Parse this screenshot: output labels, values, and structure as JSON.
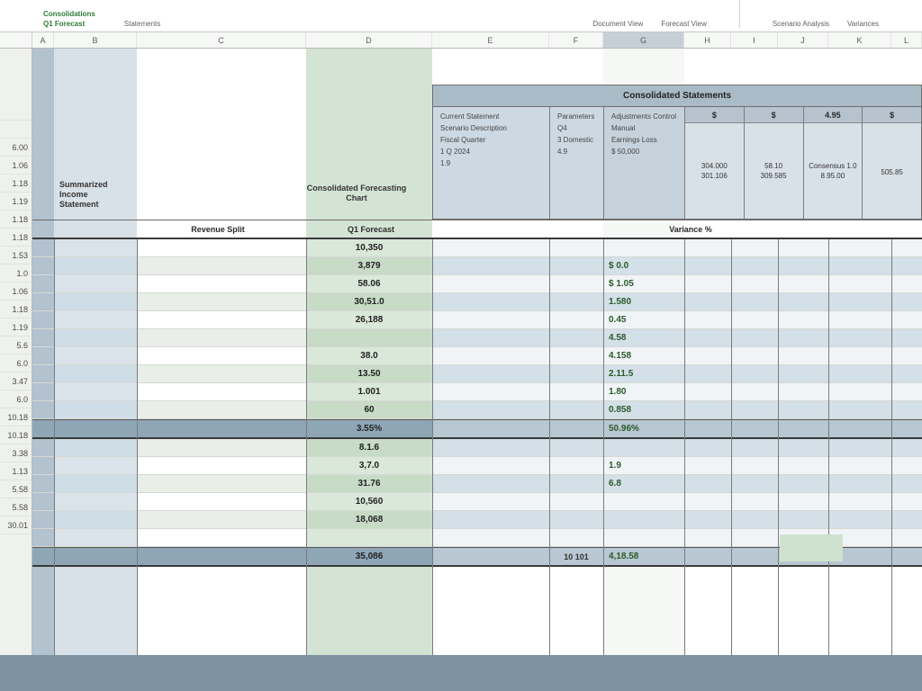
{
  "ribbon": {
    "group1_l1": "Consolidations",
    "group1_l2": "Q1 Forecast",
    "group2": "Statements",
    "pair1a": "Document View",
    "pair1b": "Forecast View",
    "pair2a": "Scenario Analysis",
    "pair2b": "Variances"
  },
  "col_letters": [
    "A",
    "B",
    "C",
    "D",
    "E",
    "F",
    "G",
    "H",
    "I",
    "J",
    "K",
    "L"
  ],
  "row_nums": [
    "",
    "",
    "",
    "6.00",
    "1.06",
    "1.18",
    "1.19",
    "1.18",
    "1.18",
    "1.53",
    "1.0",
    "1.06",
    "1.18",
    "1.19",
    "5.6",
    "6.0",
    "3.47",
    "6.0",
    "10.18",
    "10.18",
    "3.38",
    "1.13",
    "5.58",
    "5.58",
    "30.01"
  ],
  "section": {
    "left_label_1": "Summarized",
    "left_label_2": "Income",
    "left_label_3": "Statement",
    "center_label_1": "Consolidated  Forecasting",
    "center_label_2": "Chart",
    "subhead_items": "Revenue Split",
    "subhead_forecast": "Q1 Forecast",
    "subhead_var": "Variance %"
  },
  "header_band": {
    "title": "Consolidated  Statements",
    "pane1_l1": "Current Statement",
    "pane1_l2": "Scenario Description",
    "pane1_l3": "Fiscal Quarter",
    "pane1_v1": "1 Q  2024",
    "pane1_v2": "1.9",
    "pane2_l1": "Parameters",
    "pane2_l2": "Q4",
    "pane2_l3": "3 Domestic",
    "pane2_l4": "4.9",
    "pane3_l1": "Adjustments Control",
    "pane3_l2": "Manual",
    "pane3_l3": "Earnings  Loss",
    "pane3_l4": "$ 50,000",
    "mini_heads": [
      "$",
      "$",
      "4.95",
      "$"
    ],
    "mini_r1": [
      "304.000",
      "58.10",
      "Consensus 1.0",
      ""
    ],
    "mini_r2": [
      "301.106",
      "309.585",
      "8.95.00",
      "505.85"
    ]
  },
  "data": [
    {
      "d": "10,350",
      "g": ""
    },
    {
      "d": "3,879",
      "g": "$ 0.0"
    },
    {
      "d": "58.06",
      "g": "$ 1.05"
    },
    {
      "d": "30,51.0",
      "g": "1.580"
    },
    {
      "d": "26,188",
      "g": "0.45"
    },
    {
      "d": "",
      "g": "4.58"
    },
    {
      "d": "38.0",
      "g": "4.158"
    },
    {
      "d": "13.50",
      "g": "2.11.5"
    },
    {
      "d": "1.001",
      "g": "1.80"
    },
    {
      "d": "60",
      "g": "0.858"
    },
    {
      "d": "3.55%",
      "g": "50.96%",
      "total": true
    },
    {
      "d": "8.1.6",
      "g": ""
    },
    {
      "d": "3,7.0",
      "g": "1.9"
    },
    {
      "d": "31.76",
      "g": "6.8"
    },
    {
      "d": "10,560",
      "g": ""
    },
    {
      "d": "18,068",
      "g": ""
    },
    {
      "d": "",
      "g": ""
    },
    {
      "d": "35,086",
      "f": "10 101",
      "g": "4,18.58",
      "total": true
    }
  ]
}
